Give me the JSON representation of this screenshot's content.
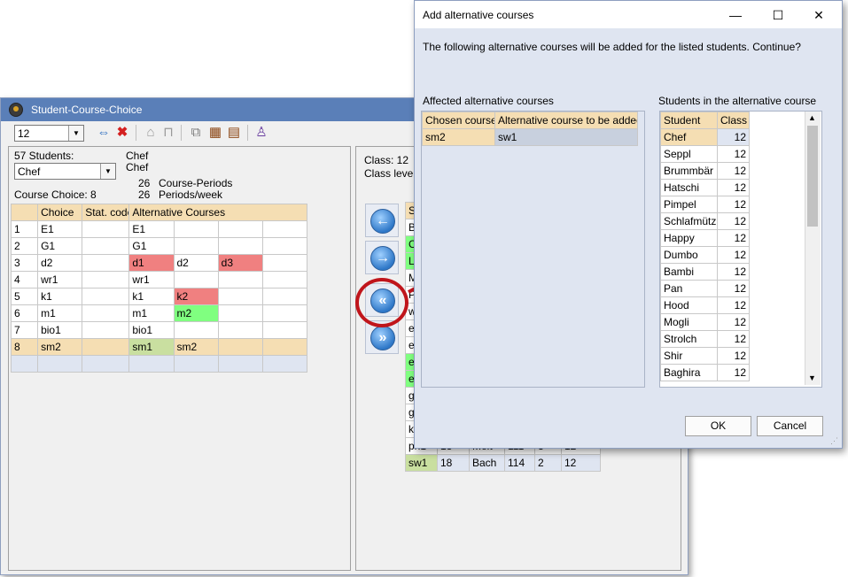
{
  "main_window": {
    "title": "Student-Course-Choice",
    "class_selector": "12"
  },
  "left": {
    "students_count": "57 Students:",
    "student_selector": "Chef",
    "student_name_1": "Chef",
    "student_name_2": "Chef",
    "course_periods_value": "26",
    "course_periods_label": "Course-Periods",
    "periods_week_value": "26",
    "periods_week_label": "Periods/week",
    "course_choice": "Course Choice: 8",
    "table": {
      "headers": [
        "",
        "Choice",
        "Stat. code",
        "Alternative Courses",
        "",
        "",
        ""
      ],
      "rows": [
        [
          "1",
          "E1",
          "",
          "E1",
          "",
          "",
          ""
        ],
        [
          "2",
          "G1",
          "",
          "G1",
          "",
          "",
          ""
        ],
        [
          "3",
          "d2",
          "",
          "d1",
          "d2",
          "d3",
          ""
        ],
        [
          "4",
          "wr1",
          "",
          "wr1",
          "",
          "",
          ""
        ],
        [
          "5",
          "k1",
          "",
          "k1",
          "k2",
          "",
          ""
        ],
        [
          "6",
          "m1",
          "",
          "m1",
          "m2",
          "",
          ""
        ],
        [
          "7",
          "bio1",
          "",
          "bio1",
          "",
          "",
          ""
        ],
        [
          "8",
          "sm2",
          "",
          "sm1",
          "sm2",
          "",
          ""
        ]
      ]
    }
  },
  "middle": {
    "class_label": "Class: 12",
    "class_level_label": "Class level:",
    "partial_col": [
      "S",
      "B",
      "C",
      "L",
      "M",
      "P",
      "w",
      "e",
      "e",
      "e",
      "e",
      "g",
      "g",
      "ku"
    ],
    "rows": [
      [
        "ph1",
        "13",
        "Meit",
        "111",
        "3",
        "12"
      ],
      [
        "sw1",
        "18",
        "Bach",
        "114",
        "2",
        "12"
      ]
    ]
  },
  "dialog": {
    "title": "Add alternative courses",
    "message": "The following alternative courses will be added for the listed students. Continue?",
    "affected_label": "Affected alternative courses",
    "students_label": "Students in the alternative course",
    "affected_headers": [
      "Chosen course",
      "Alternative course to be added"
    ],
    "affected_rows": [
      [
        "sm2",
        "sw1"
      ]
    ],
    "students_headers": [
      "Student",
      "Class"
    ],
    "students_rows": [
      [
        "Chef",
        "12"
      ],
      [
        "Seppl",
        "12"
      ],
      [
        "Brummbär",
        "12"
      ],
      [
        "Hatschi",
        "12"
      ],
      [
        "Pimpel",
        "12"
      ],
      [
        "Schlafmütz",
        "12"
      ],
      [
        "Happy",
        "12"
      ],
      [
        "Dumbo",
        "12"
      ],
      [
        "Bambi",
        "12"
      ],
      [
        "Pan",
        "12"
      ],
      [
        "Hood",
        "12"
      ],
      [
        "Mogli",
        "12"
      ],
      [
        "Strolch",
        "12"
      ],
      [
        "Shir",
        "12"
      ],
      [
        "Baghira",
        "12"
      ]
    ],
    "ok_label": "OK",
    "cancel_label": "Cancel",
    "minimize_glyph": "—",
    "maximize_glyph": "☐",
    "close_glyph": "✕"
  },
  "colors": {
    "title_blue": "#5a7fb8",
    "header_tan": "#f5deb3",
    "highlight_red": "#f08080",
    "highlight_green": "#80ff80",
    "callout_red": "#c0151b"
  }
}
